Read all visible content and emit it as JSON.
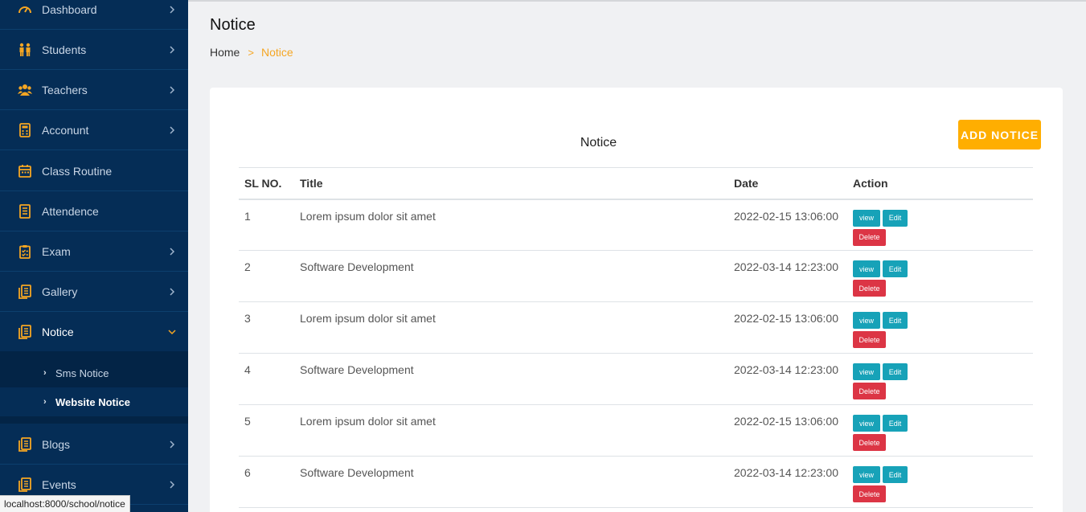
{
  "sidebar": {
    "items": [
      {
        "label": "Dashboard",
        "icon": "gauge-icon",
        "chevron": "right"
      },
      {
        "label": "Students",
        "icon": "students-icon",
        "chevron": "right"
      },
      {
        "label": "Teachers",
        "icon": "teachers-icon",
        "chevron": "right"
      },
      {
        "label": "Acconunt",
        "icon": "calculator-icon",
        "chevron": "right"
      },
      {
        "label": "Class Routine",
        "icon": "calendar-icon",
        "chevron": ""
      },
      {
        "label": "Attendence",
        "icon": "document-icon",
        "chevron": ""
      },
      {
        "label": "Exam",
        "icon": "clipboard-icon",
        "chevron": "right"
      },
      {
        "label": "Gallery",
        "icon": "gallery-icon",
        "chevron": "right"
      },
      {
        "label": "Notice",
        "icon": "notice-icon",
        "chevron": "down"
      },
      {
        "label": "Blogs",
        "icon": "blogs-icon",
        "chevron": "right"
      },
      {
        "label": "Events",
        "icon": "events-icon",
        "chevron": "right"
      }
    ],
    "submenu": [
      {
        "label": "Sms Notice"
      },
      {
        "label": "Website Notice"
      }
    ]
  },
  "header": {
    "title": "Notice",
    "breadcrumb": {
      "home": "Home",
      "separator": ">",
      "current": "Notice"
    }
  },
  "card": {
    "title": "Notice",
    "add_button": "ADD NOTICE",
    "columns": [
      "SL NO.",
      "Title",
      "Date",
      "Action"
    ],
    "rows": [
      {
        "sl": "1",
        "title": "Lorem ipsum dolor sit amet",
        "date": "2022-02-15 13:06:00"
      },
      {
        "sl": "2",
        "title": "Software Development",
        "date": "2022-03-14 12:23:00"
      },
      {
        "sl": "3",
        "title": "Lorem ipsum dolor sit amet",
        "date": "2022-02-15 13:06:00"
      },
      {
        "sl": "4",
        "title": "Software Development",
        "date": "2022-03-14 12:23:00"
      },
      {
        "sl": "5",
        "title": "Lorem ipsum dolor sit amet",
        "date": "2022-02-15 13:06:00"
      },
      {
        "sl": "6",
        "title": "Software Development",
        "date": "2022-03-14 12:23:00"
      }
    ],
    "actions": {
      "view": "view",
      "edit": "Edit",
      "delete": "Delete"
    }
  },
  "statusbar": {
    "url": "localhost:8000/school/notice"
  },
  "colors": {
    "sidebar_bg": "#052d56",
    "accent": "#f5a623",
    "button_primary": "#ffae01",
    "btn_info": "#17a2b8",
    "btn_danger": "#dc3545"
  }
}
